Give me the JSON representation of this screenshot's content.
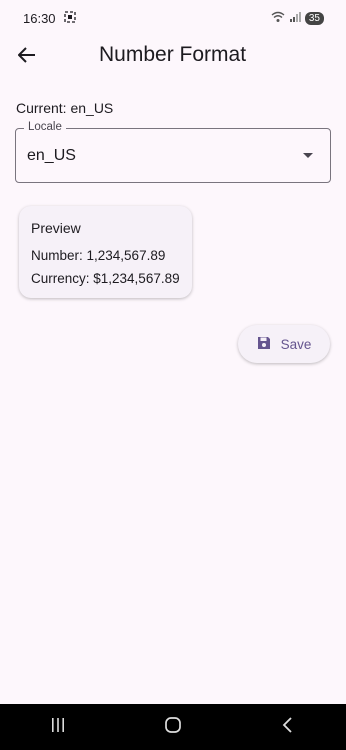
{
  "status": {
    "time": "16:30",
    "battery": "35"
  },
  "app_bar": {
    "title": "Number Format"
  },
  "current_label": "Current: en_US",
  "locale_field": {
    "label": "Locale",
    "value": "en_US"
  },
  "preview": {
    "title": "Preview",
    "number_line": "Number: 1,234,567.89",
    "currency_line": "Currency: $1,234,567.89"
  },
  "save_button": {
    "label": "Save"
  },
  "colors": {
    "accent": "#65558f",
    "background": "#fdf7fc",
    "card": "#f6f1f8"
  }
}
